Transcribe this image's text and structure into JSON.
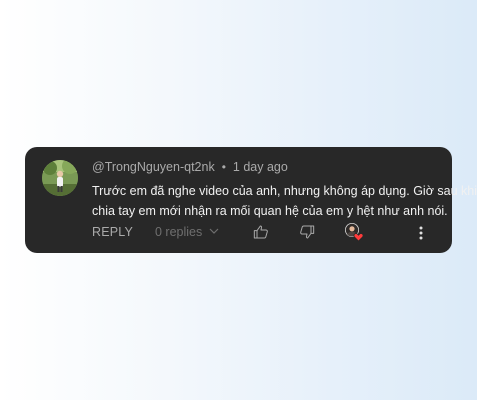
{
  "comment": {
    "username": "@TrongNguyen-qt2nk",
    "separator": "•",
    "timestamp": "1 day ago",
    "text_line_1": "Trước em đã nghe video của anh, nhưng không áp dụng. Giờ  sau khi",
    "text_line_2": "chia tay em mới nhận ra mối quan hệ của em y hệt như anh nói.",
    "reply_label": "REPLY",
    "replies_label": "0 replies",
    "icons": {
      "avatar": "user-avatar",
      "expand": "chevron-down-icon",
      "like": "thumbs-up-icon",
      "dislike": "thumbs-down-icon",
      "creator_heart": "creator-heart-icon",
      "more": "more-vertical-icon"
    },
    "colors": {
      "card_background": "#282828",
      "heart": "#ff3b3b"
    }
  }
}
